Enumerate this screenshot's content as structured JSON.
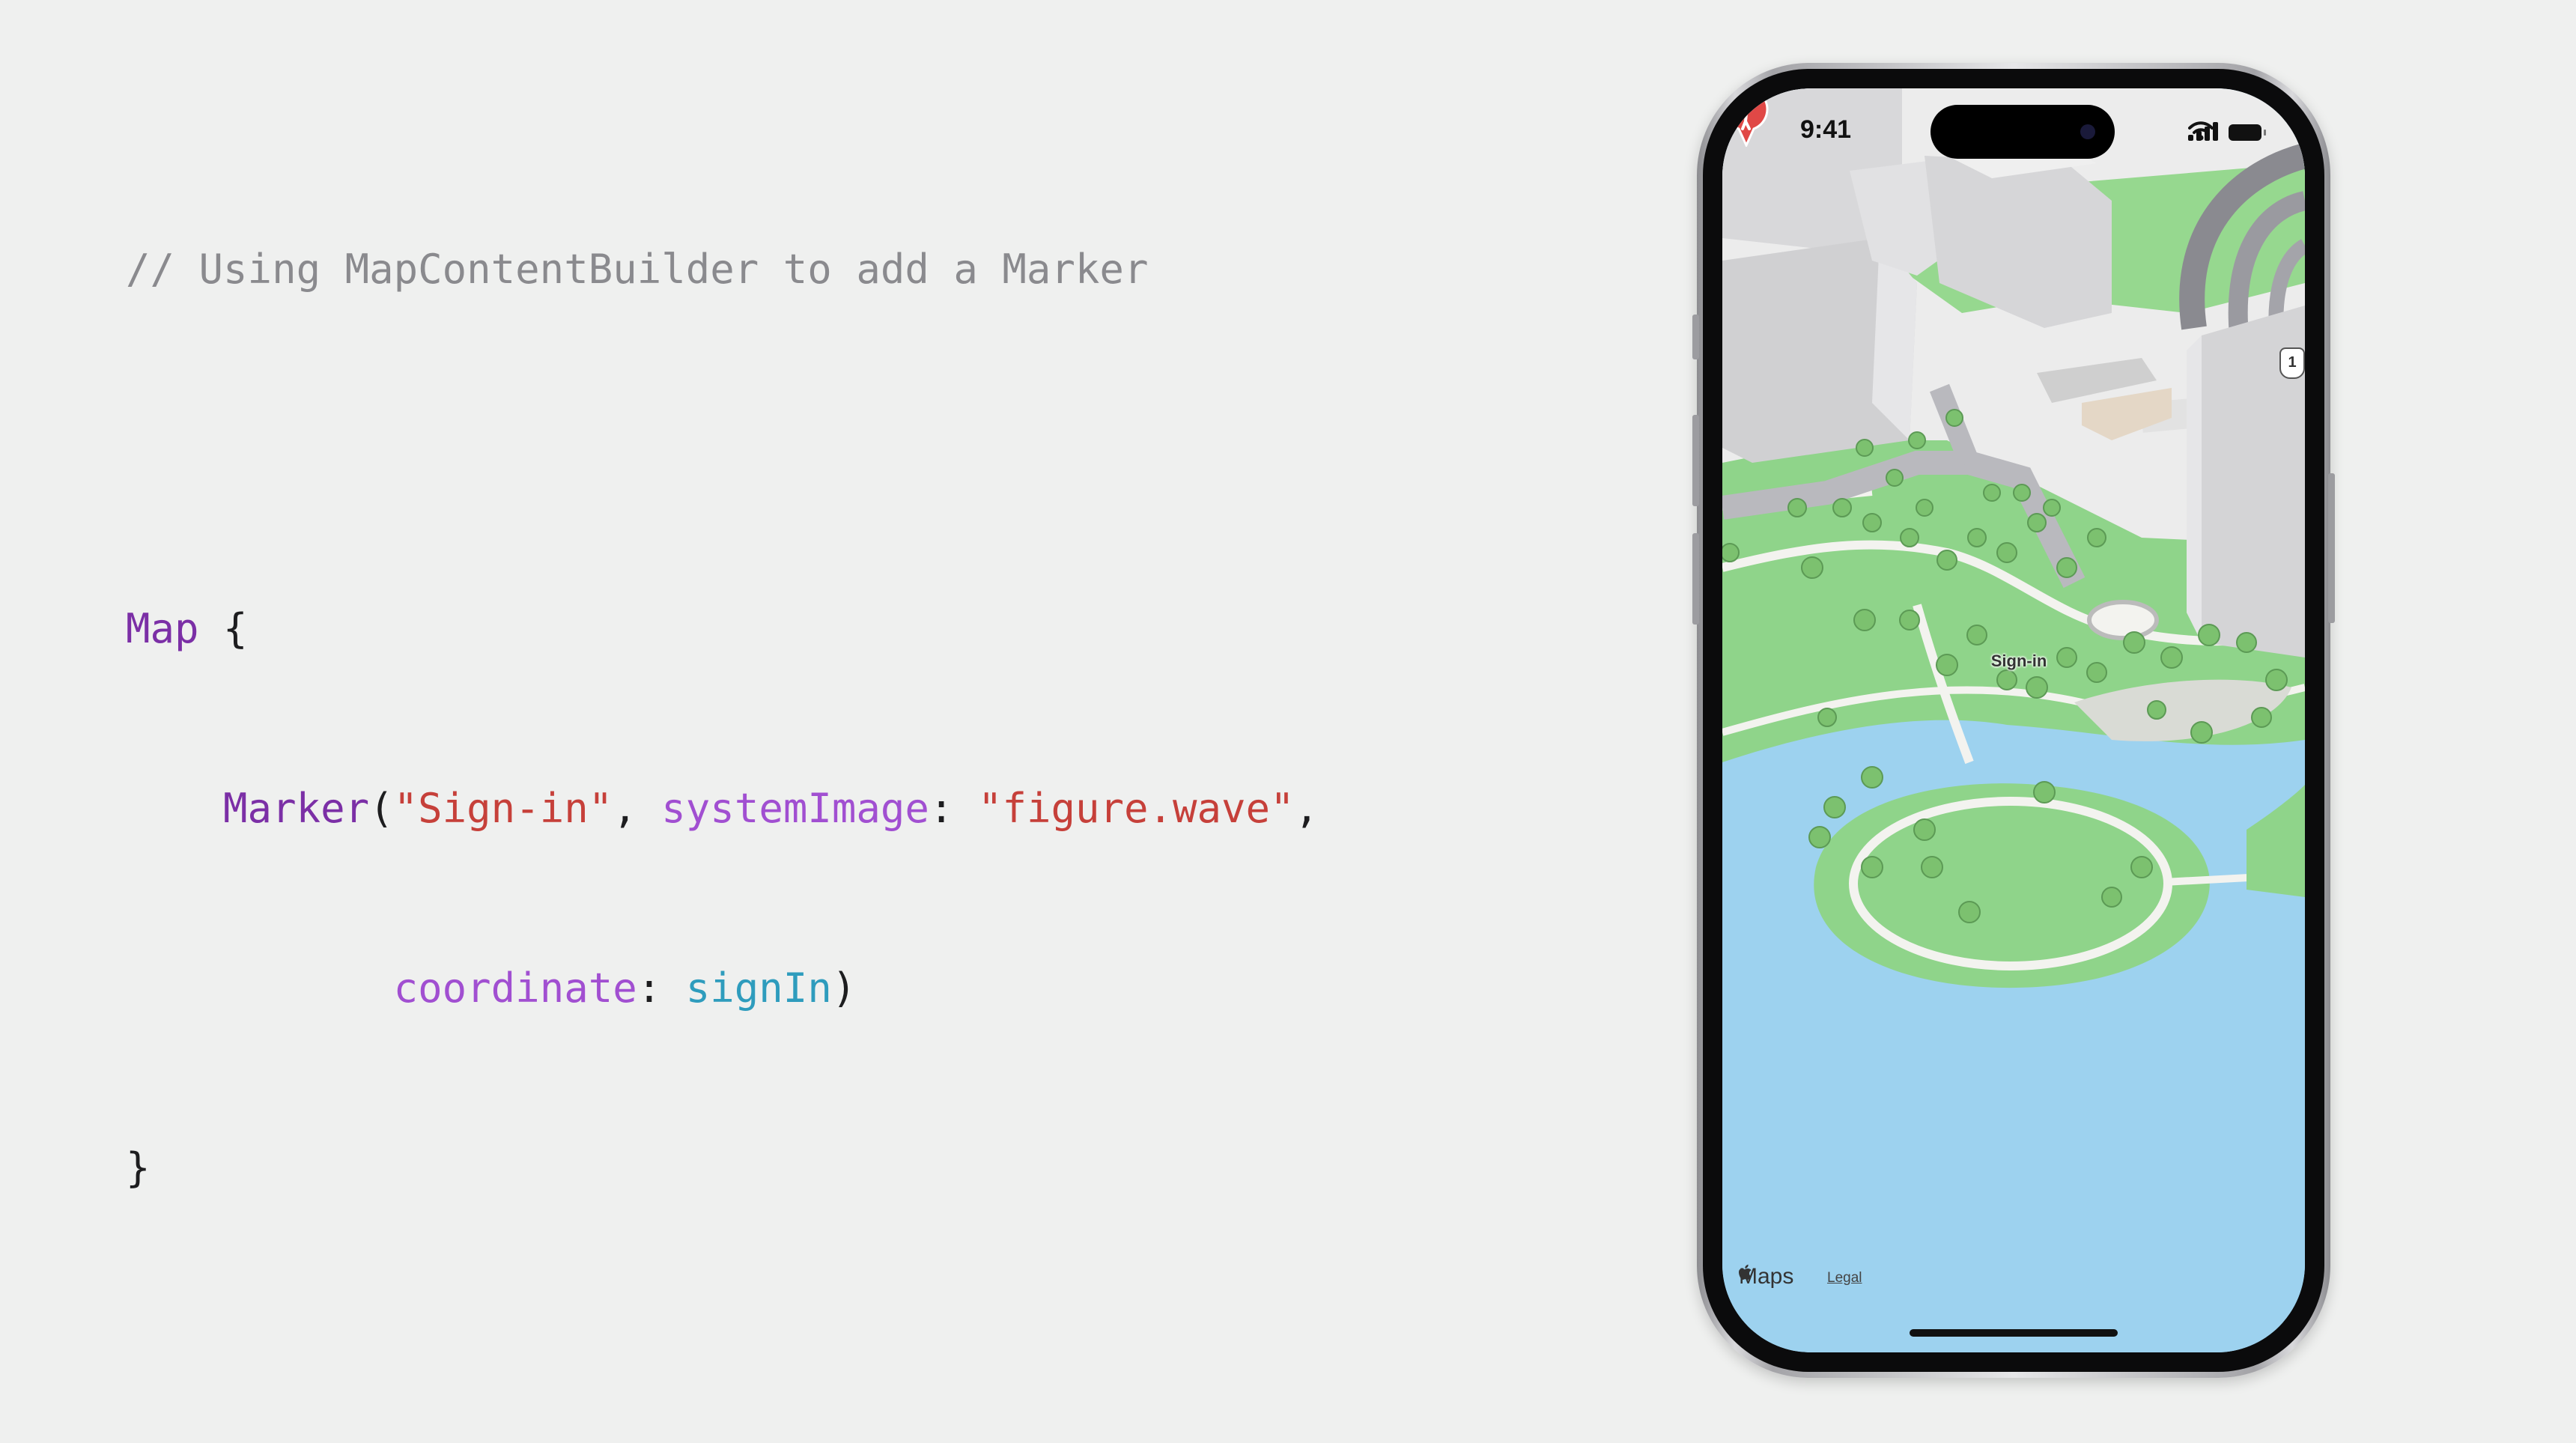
{
  "code": {
    "comment": "// Using MapContentBuilder to add a Marker",
    "map_keyword": "Map",
    "open_brace": " {",
    "marker_type": "Marker",
    "open_paren": "(",
    "marker_title": "\"Sign-in\"",
    "comma1": ", ",
    "param_system_image": "systemImage",
    "colon1": ": ",
    "system_image_value": "\"figure.wave\"",
    "comma2": ",",
    "param_coordinate": "coordinate",
    "colon2": ": ",
    "coordinate_value": "signIn",
    "close_paren": ")",
    "close_brace": "}"
  },
  "phone": {
    "status_time": "9:41",
    "marker_label": "Sign-in",
    "maps_attribution": "Maps",
    "legal_link": "Legal",
    "route_shield": "1",
    "marker_color": "#e04846",
    "water_color": "#9dd2ef",
    "park_color": "#8fd48a"
  }
}
